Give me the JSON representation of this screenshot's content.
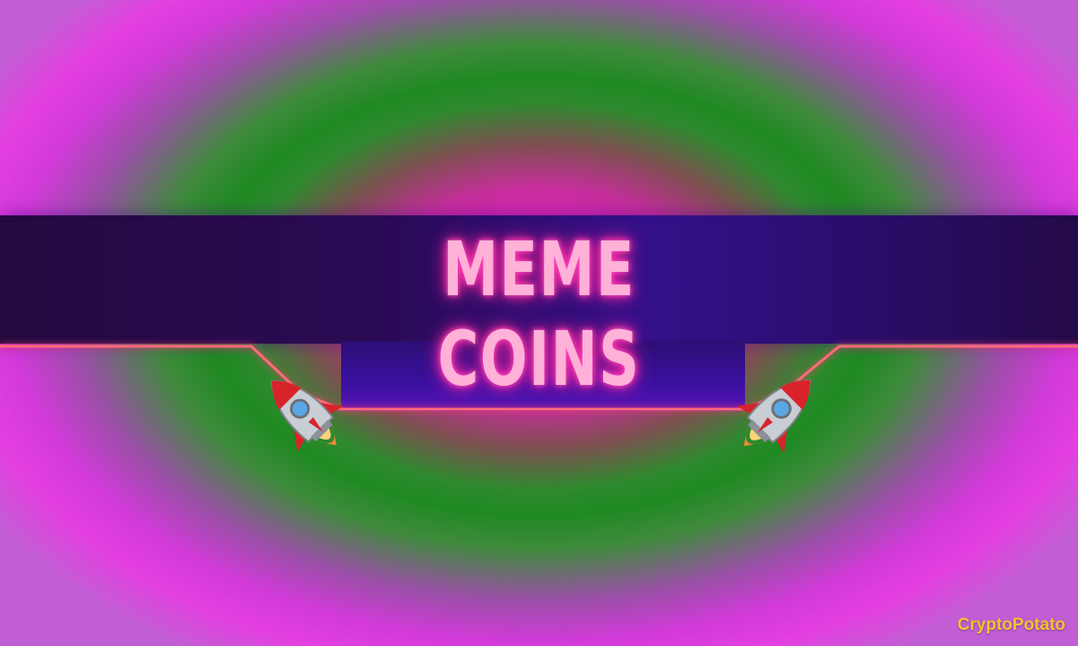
{
  "title": {
    "line1": "MEME",
    "line2": "COINS"
  },
  "watermark": "CryptoPotato",
  "decorations": {
    "left_icon": "rocket-icon",
    "right_icon": "rocket-icon"
  },
  "colors": {
    "title_text": "#ffb1d8",
    "title_glow": "#ff2fa8",
    "band": "#2b0a55",
    "neon_line": "#ff6a7a",
    "background_pink": "#f21ed0",
    "background_green": "#1f8a22",
    "watermark": "#f2c232"
  }
}
